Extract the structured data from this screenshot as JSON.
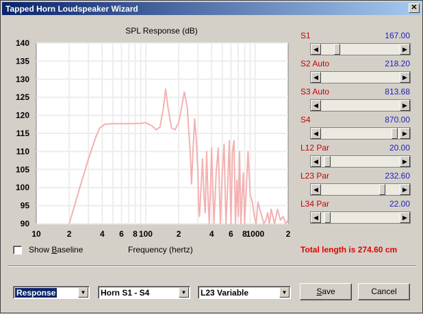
{
  "window": {
    "title": "Tapped Horn Loudspeaker Wizard",
    "close_glyph": "✕"
  },
  "chart_data": {
    "type": "line",
    "title": "SPL Response (dB)",
    "xlabel": "Frequency (hertz)",
    "ylabel": "",
    "x_scale": "log",
    "xlim": [
      10,
      2000
    ],
    "ylim": [
      90,
      140
    ],
    "x_ticks": [
      {
        "value": 10,
        "label": "10"
      },
      {
        "value": 20,
        "label": "2"
      },
      {
        "value": 40,
        "label": "4"
      },
      {
        "value": 60,
        "label": "6"
      },
      {
        "value": 80,
        "label": "8"
      },
      {
        "value": 100,
        "label": "100"
      },
      {
        "value": 200,
        "label": "2"
      },
      {
        "value": 400,
        "label": "4"
      },
      {
        "value": 600,
        "label": "6"
      },
      {
        "value": 800,
        "label": "8"
      },
      {
        "value": 1000,
        "label": "1000"
      },
      {
        "value": 2000,
        "label": "2"
      }
    ],
    "y_ticks": [
      90,
      95,
      100,
      105,
      110,
      115,
      120,
      125,
      130,
      135,
      140
    ],
    "grid": true,
    "series": [
      {
        "color": "#f4b0b0",
        "x": [
          20,
          25,
          30,
          35,
          38,
          42,
          50,
          70,
          90,
          100,
          115,
          125,
          135,
          145,
          152,
          160,
          172,
          185,
          200,
          212,
          225,
          240,
          248,
          255,
          262,
          270,
          280,
          290,
          300,
          305,
          310,
          320,
          330,
          340,
          350,
          360,
          370,
          380,
          390,
          400,
          410,
          420,
          440,
          460,
          480,
          500,
          520,
          540,
          560,
          580,
          600,
          620,
          640,
          660,
          680,
          700,
          720,
          740,
          760,
          780,
          800,
          830,
          860,
          900,
          940,
          980,
          1020,
          1060,
          1100,
          1150,
          1200,
          1250,
          1300,
          1350,
          1400,
          1450,
          1500,
          1550,
          1600,
          1700,
          1800,
          1900,
          2000
        ],
        "y": [
          90,
          100,
          108,
          114,
          116.5,
          117.5,
          117.7,
          117.7,
          117.8,
          118,
          117,
          116,
          116.8,
          122,
          127.3,
          122,
          116.5,
          116,
          118,
          122,
          126.5,
          122,
          115,
          110,
          101,
          110,
          119,
          113,
          104,
          94,
          92,
          100,
          108,
          98,
          93,
          110,
          98,
          90,
          100,
          111,
          100,
          90,
          104,
          111,
          90,
          104,
          112,
          90,
          100,
          113,
          90,
          110,
          113,
          90,
          102,
          92,
          110,
          90,
          98,
          104,
          90,
          100,
          110,
          98,
          96,
          92,
          90,
          96,
          94,
          92,
          90,
          91,
          93,
          90,
          94,
          92,
          90,
          92,
          94,
          91,
          92,
          90,
          91
        ]
      }
    ]
  },
  "baseline": {
    "label": "Show Baseline",
    "checked": false
  },
  "params": [
    {
      "label": "S1",
      "value": "167.00",
      "level": 0.18
    },
    {
      "label": "S2  Auto",
      "value": "218.20",
      "level": 1.0
    },
    {
      "label": "S3  Auto",
      "value": "813.68",
      "level": 1.0
    },
    {
      "label": "S4",
      "value": "870.00",
      "level": 0.97
    },
    {
      "label": "L12  Par",
      "value": "20.00",
      "level": 0.05
    },
    {
      "label": "L23  Par",
      "value": "232.60",
      "level": 0.8
    },
    {
      "label": "L34  Par",
      "value": "22.00",
      "level": 0.05
    }
  ],
  "total_length": "Total length is 274.60 cm",
  "combos": {
    "view": "Response",
    "horn": "Horn S1 - S4",
    "variable": "L23 Variable"
  },
  "buttons": {
    "save": "Save",
    "cancel": "Cancel"
  }
}
